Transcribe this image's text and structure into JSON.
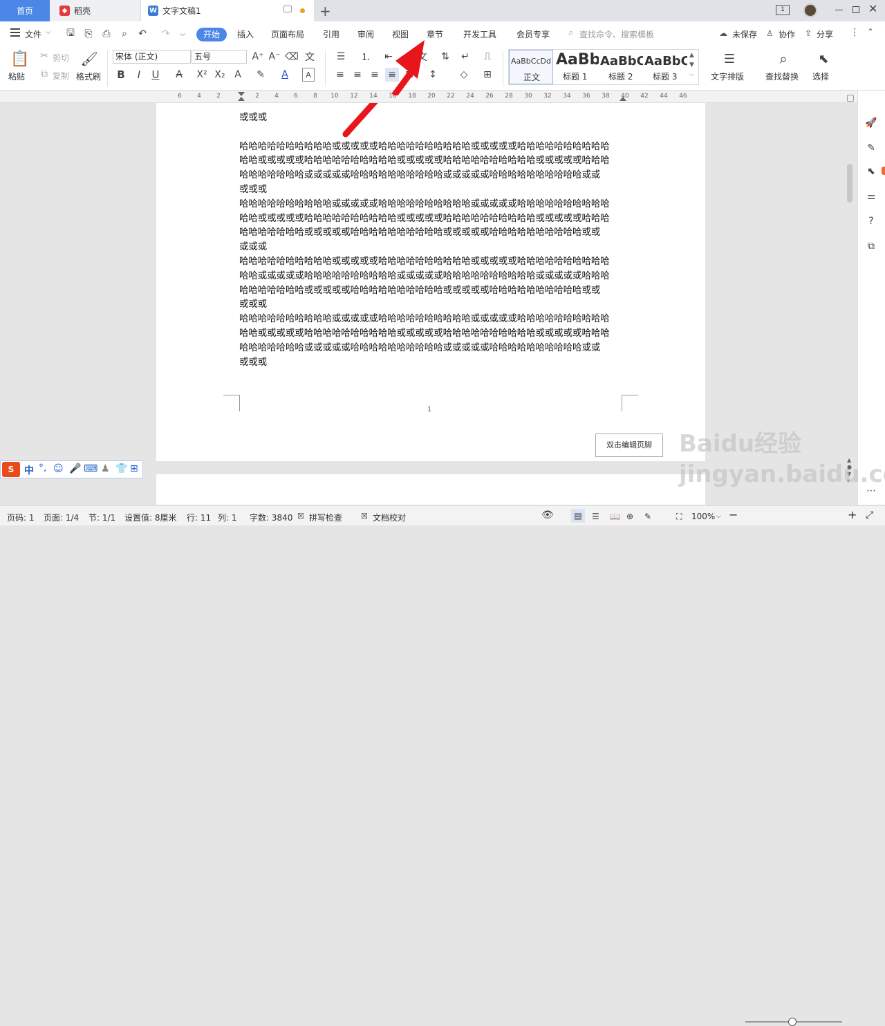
{
  "tabs": {
    "home": "首页",
    "daoke": "稻壳",
    "doc": "文字文稿1"
  },
  "menu": {
    "file": "文件",
    "items": [
      "开始",
      "插入",
      "页面布局",
      "引用",
      "审阅",
      "视图",
      "章节",
      "开发工具",
      "会员专享"
    ],
    "search_placeholder": "查找命令、搜索模板",
    "unsaved": "未保存",
    "collab": "协作",
    "share": "分享"
  },
  "ribbon": {
    "paste": "粘贴",
    "cut": "剪切",
    "copy": "复制",
    "format_painter": "格式刷",
    "font_name": "宋体 (正文)",
    "font_size": "五号",
    "styles": [
      {
        "preview": "AaBbCcDd",
        "name": "正文"
      },
      {
        "preview": "AaBb",
        "name": "标题 1"
      },
      {
        "preview": "AaBbC",
        "name": "标题 2"
      },
      {
        "preview": "AaBbC",
        "name": "标题 3"
      }
    ],
    "text_layout": "文字排版",
    "find_replace": "查找替换",
    "select": "选择"
  },
  "ruler_ticks": [
    "6",
    "4",
    "2",
    "2",
    "4",
    "6",
    "8",
    "10",
    "12",
    "14",
    "16",
    "18",
    "20",
    "22",
    "24",
    "26",
    "28",
    "30",
    "32",
    "34",
    "36",
    "38",
    "40",
    "42",
    "44",
    "46"
  ],
  "document": {
    "lines": [
      "或或或",
      "",
      "哈哈哈哈哈哈哈哈哈哈或或或或或哈哈哈哈哈哈哈哈哈哈或或或或或哈哈哈哈哈哈哈哈哈哈",
      "哈哈或或或或或哈哈哈哈哈哈哈哈哈哈或或或或或哈哈哈哈哈哈哈哈哈哈或或或或或哈哈哈",
      "哈哈哈哈哈哈哈或或或或或哈哈哈哈哈哈哈哈哈哈或或或或或哈哈哈哈哈哈哈哈哈哈或或",
      "或或或",
      "哈哈哈哈哈哈哈哈哈哈或或或或或哈哈哈哈哈哈哈哈哈哈或或或或或哈哈哈哈哈哈哈哈哈哈",
      "哈哈或或或或或哈哈哈哈哈哈哈哈哈哈或或或或或哈哈哈哈哈哈哈哈哈哈或或或或或哈哈哈",
      "哈哈哈哈哈哈哈或或或或或哈哈哈哈哈哈哈哈哈哈或或或或或哈哈哈哈哈哈哈哈哈哈或或",
      "或或或",
      "哈哈哈哈哈哈哈哈哈哈或或或或或哈哈哈哈哈哈哈哈哈哈或或或或或哈哈哈哈哈哈哈哈哈哈",
      "哈哈或或或或或哈哈哈哈哈哈哈哈哈哈或或或或或哈哈哈哈哈哈哈哈哈哈或或或或或哈哈哈",
      "哈哈哈哈哈哈哈或或或或或哈哈哈哈哈哈哈哈哈哈或或或或或哈哈哈哈哈哈哈哈哈哈或或",
      "或或或",
      "哈哈哈哈哈哈哈哈哈哈或或或或或哈哈哈哈哈哈哈哈哈哈或或或或或哈哈哈哈哈哈哈哈哈哈",
      "哈哈或或或或或哈哈哈哈哈哈哈哈哈哈或或或或或哈哈哈哈哈哈哈哈哈哈或或或或或哈哈哈",
      "哈哈哈哈哈哈哈或或或或或哈哈哈哈哈哈哈哈哈哈或或或或或哈哈哈哈哈哈哈哈哈哈或或",
      "或或或"
    ],
    "page_number": "1",
    "edit_footer": "双击编辑页脚"
  },
  "ime": {
    "mode": "中"
  },
  "status": {
    "page": "页码: 1",
    "pages": "页面: 1/4",
    "section": "节: 1/1",
    "setting": "设置值: 8厘米",
    "row": "行: 11",
    "col": "列: 1",
    "words": "字数: 3840",
    "spell": "拼写检查",
    "proof": "文档校对",
    "zoom": "100%"
  },
  "watermark": "Baidu经验 jingyan.baidu.com",
  "colors": {
    "accent": "#4b87e6",
    "arrow": "#e8151b",
    "wps_red": "#e5393d"
  }
}
